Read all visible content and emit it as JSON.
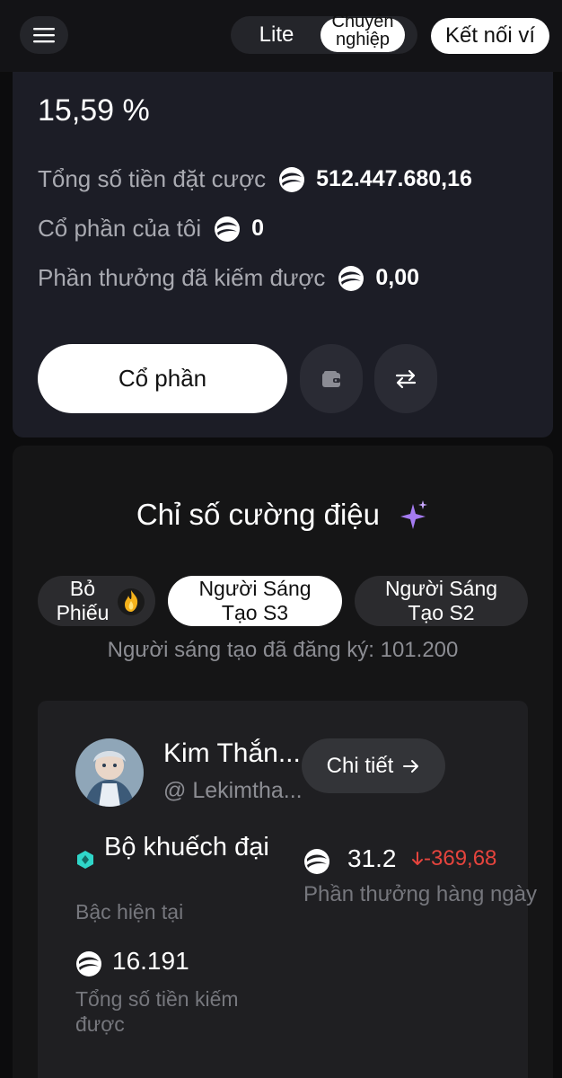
{
  "header": {
    "mode_lite": "Lite",
    "mode_pro": "Chuyên nghiệp",
    "connect_wallet": "Kết nối ví"
  },
  "staking": {
    "apr": "15,59 %",
    "total_staked_label": "Tổng số tiền đặt cược",
    "total_staked_value": "512.447.680,16",
    "my_shares_label": "Cổ phần của tôi",
    "my_shares_value": "0",
    "rewards_earned_label": "Phần thưởng đã kiếm được",
    "rewards_earned_value": "0,00",
    "share_button": "Cổ phần"
  },
  "hype": {
    "title": "Chỉ số cường điệu",
    "tabs": [
      {
        "label": "Bỏ Phiếu",
        "active": false
      },
      {
        "label": "Người Sáng Tạo S3",
        "active": true
      },
      {
        "label": "Người Sáng Tạo S2",
        "active": false
      }
    ],
    "registered_creators": "Người sáng tạo đã đăng ký: 101.200"
  },
  "creator": {
    "name": "Kim Thắn...",
    "handle": "@ Lekimtha...",
    "detail_button": "Chi tiết",
    "tier": "Bộ khuếch đại",
    "tier_label": "Bậc hiện tại",
    "daily_reward": "31.2",
    "daily_change": "-369,68",
    "daily_reward_label": "Phần thưởng hàng ngày",
    "total_earned": "16.191",
    "total_earned_label": "Tổng số tiền kiếm được"
  },
  "colors": {
    "negative": "#e5443d",
    "sparkle": "#a57bf2",
    "tier_icon": "#2fd6c9"
  },
  "icons": [
    "menu-icon",
    "coin-icon",
    "wallet-icon",
    "swap-icon",
    "sparkle-icon",
    "flame-icon",
    "arrow-right-icon",
    "arrow-down-icon",
    "tier-gem-icon"
  ]
}
